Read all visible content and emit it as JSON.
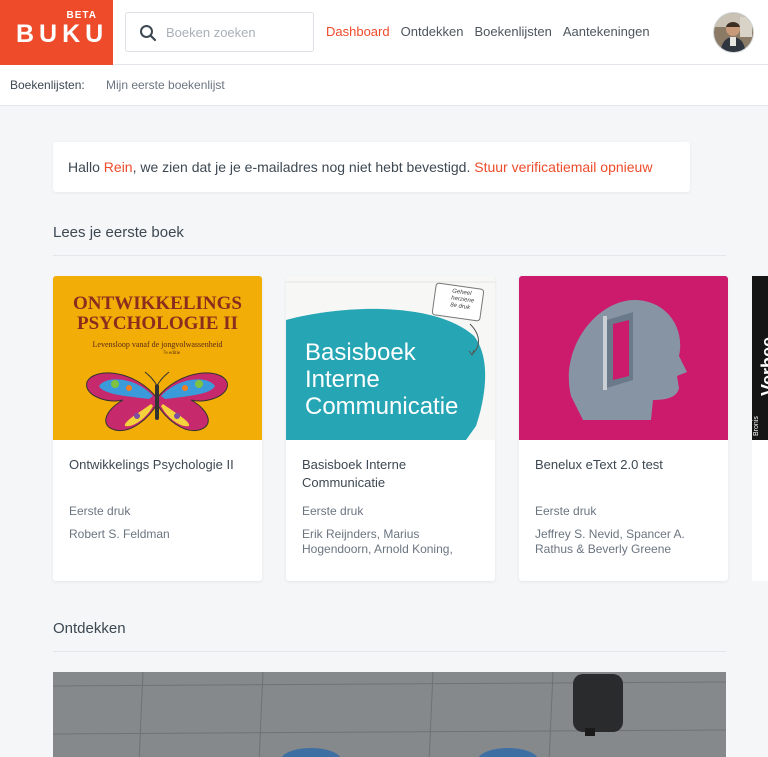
{
  "logo": {
    "beta": "BETA",
    "name": "BUKU"
  },
  "search": {
    "placeholder": "Boeken zoeken"
  },
  "nav": [
    {
      "label": "Dashboard",
      "active": true
    },
    {
      "label": "Ontdekken",
      "active": false
    },
    {
      "label": "Boekenlijsten",
      "active": false
    },
    {
      "label": "Aantekeningen",
      "active": false
    }
  ],
  "subbar": {
    "label": "Boekenlijsten:",
    "item": "Mijn eerste boekenlijst"
  },
  "alert": {
    "prefix": "Hallo ",
    "name": "Rein",
    "message": ", we zien dat je je e-mailadres nog niet hebt bevestigd. ",
    "link": "Stuur verificatiemail opnieuw"
  },
  "sections": {
    "first_book": "Lees je eerste boek",
    "discover": "Ontdekken"
  },
  "books": [
    {
      "title": "Ontwikkelings Psychologie II",
      "edition": "Eerste druk",
      "authors": "Robert S. Feldman",
      "cover": {
        "line1": "ONTWIKKELINGS",
        "line2": "PSYCHOLOGIE II",
        "subtitle": "Levensloop vanaf de jongvolwassenheid",
        "edition": "7e editie",
        "bg": "#f2ae06"
      }
    },
    {
      "title": "Basisboek Interne Communicatie",
      "edition": "Eerste druk",
      "authors": "Erik Reijnders, Marius Hogendoorn, Arnold Koning,",
      "cover": {
        "line1": "Basisboek",
        "line2": "Interne",
        "line3": "Communicatie",
        "note1": "Geheel",
        "note2": "herziene",
        "note3": "8e druk",
        "bg": "#26a5b4"
      }
    },
    {
      "title": "Benelux eText 2.0 test",
      "edition": "Eerste druk",
      "authors": "Jeffrey S. Nevid, Spancer A. Rathus & Beverly Greene",
      "cover": {
        "bg": "#cc1a6c"
      }
    }
  ],
  "partial_cover": {
    "line1": "Bronis",
    "line2": "Verbee"
  },
  "colors": {
    "accent": "#ee4b2b",
    "page_bg": "#f4f6f8"
  }
}
